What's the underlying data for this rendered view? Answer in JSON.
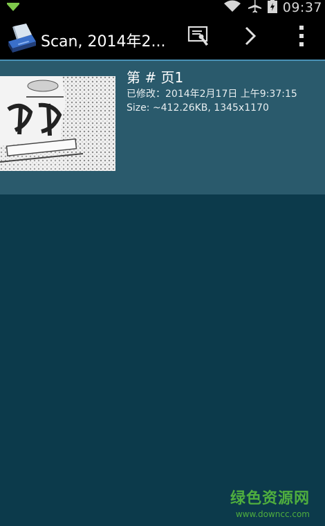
{
  "status_bar": {
    "time": "09:37",
    "icons": [
      "notification-arrow-icon",
      "wifi-icon",
      "airplane-icon",
      "battery-icon"
    ]
  },
  "action_bar": {
    "title": "Scan, 2014年2...",
    "icons": [
      "scanner-app-icon",
      "select-items-icon",
      "chevron-right-icon",
      "overflow-menu-icon"
    ]
  },
  "list": {
    "items": [
      {
        "title": "第 # 页1",
        "modified": "已修改：2014年2月17日 上午9:37:15",
        "size": "Size: ~412.26KB, 1345x1170"
      }
    ]
  },
  "watermark": {
    "name": "绿色资源网",
    "url": "www.downcc.com"
  },
  "colors": {
    "background": "#0c3a4b",
    "list_item": "#2a5a6c",
    "accent_line": "#4a93b8",
    "watermark": "#4fae3e"
  }
}
